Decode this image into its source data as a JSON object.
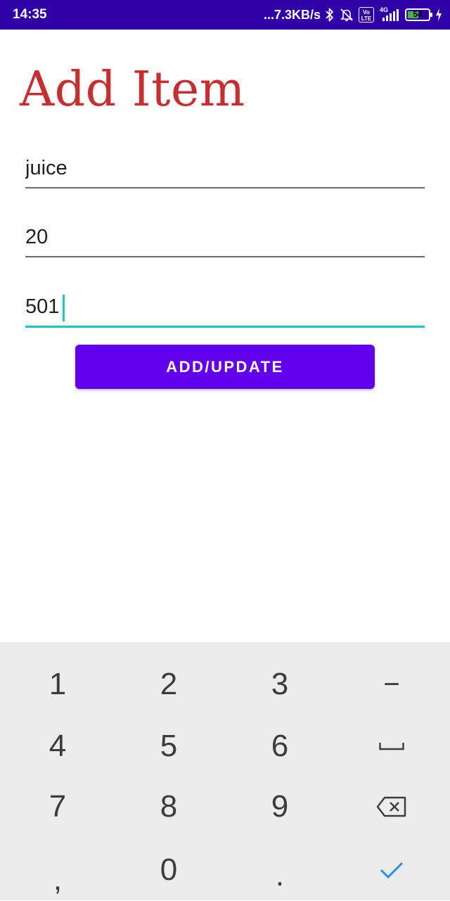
{
  "status_bar": {
    "time": "14:35",
    "network_speed": "...7.3KB/s",
    "volte_line1": "Vo",
    "volte_line2": "LTE",
    "network_type": "4G",
    "battery_level": "54",
    "battery_fraction": 0.54,
    "icons": [
      "bluetooth-icon",
      "bell-off-icon",
      "volte-icon",
      "signal-icon",
      "battery-icon",
      "charging-icon"
    ]
  },
  "page": {
    "title": "Add Item",
    "title_color": "#c62f2f"
  },
  "form": {
    "fields": [
      {
        "value": "juice",
        "focused": false
      },
      {
        "value": "20",
        "focused": false
      },
      {
        "value": "501",
        "focused": true
      }
    ],
    "submit_label": "ADD/UPDATE",
    "accent_color": "#1cc7bf",
    "button_color": "#6200ee"
  },
  "keyboard": {
    "rows": [
      [
        "1",
        "2",
        "3",
        "−"
      ],
      [
        "4",
        "5",
        "6",
        "space"
      ],
      [
        "7",
        "8",
        "9",
        "backspace"
      ],
      [
        ",",
        "0",
        ".",
        "done"
      ]
    ],
    "labels": {
      "k1": "1",
      "k2": "2",
      "k3": "3",
      "minus": "−",
      "k4": "4",
      "k5": "5",
      "k6": "6",
      "k7": "7",
      "k8": "8",
      "k9": "9",
      "comma": ",",
      "k0": "0",
      "period": "."
    },
    "done_color": "#2f8de4"
  }
}
